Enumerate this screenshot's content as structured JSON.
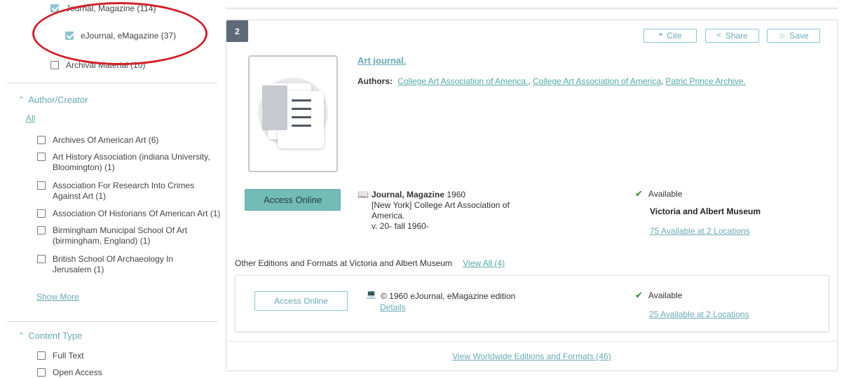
{
  "sidebar": {
    "format_facets": [
      {
        "label": "Journal, Magazine (114)",
        "checked": true
      },
      {
        "label": "eJournal, eMagazine (37)",
        "checked": true
      },
      {
        "label": "Archival Material (10)",
        "checked": false
      }
    ],
    "author_section": {
      "heading": "Author/Creator",
      "all_link": "All",
      "items": [
        {
          "label": "Archives Of American Art (6)"
        },
        {
          "label": "Art History Association (indiana University, Bloomington) (1)"
        },
        {
          "label": "Association For Research Into Crimes Against Art (1)"
        },
        {
          "label": "Association Of Historians Of American Art (1)"
        },
        {
          "label": "Birmingham Municipal School Of Art (birmingham, England) (1)"
        },
        {
          "label": "British School Of Archaeology In Jerusalem (1)"
        }
      ],
      "show_more": "Show More"
    },
    "content_type_section": {
      "heading": "Content Type",
      "items": [
        {
          "label": "Full Text"
        },
        {
          "label": "Open Access"
        }
      ]
    },
    "annotation_color": "#d21f26"
  },
  "result": {
    "number": "2",
    "actions": {
      "cite": "Cite",
      "share": "Share",
      "save": "Save"
    },
    "title": "Art journal.",
    "authors_label": "Authors:",
    "authors": [
      "College Art Association of America.",
      "College Art Association of America",
      "Patric Prince Archive."
    ],
    "authors_sep": ", ",
    "access_online": "Access Online",
    "format": "Journal, Magazine",
    "year": "1960",
    "publisher_line1": "[New York] College Art Association of",
    "publisher_line2": "America.",
    "holdings": "v. 20- fall 1960-",
    "availability": "Available",
    "library": "Victoria and Albert Museum",
    "locations_link": "75 Available at 2 Locations",
    "other_editions_text": "Other Editions and Formats at Victoria and Albert Museum",
    "view_all": "View All (4)",
    "edition": {
      "access_online": "Access Online",
      "text": "© 1960 eJournal, eMagazine edition",
      "details": "Details",
      "availability": "Available",
      "locations_link": "25 Available at 2 Locations"
    },
    "worldwide_link": "View Worldwide Editions and Formats (46)"
  },
  "colors": {
    "accent": "#6aa9b6",
    "button_fill": "#72bbb6",
    "badge": "#5e6a78",
    "available_check": "#2e8b2e"
  },
  "icons": [
    "check-icon",
    "chevron-up-icon",
    "quote-icon",
    "share-icon",
    "star-icon",
    "book-icon",
    "monitor-icon"
  ]
}
